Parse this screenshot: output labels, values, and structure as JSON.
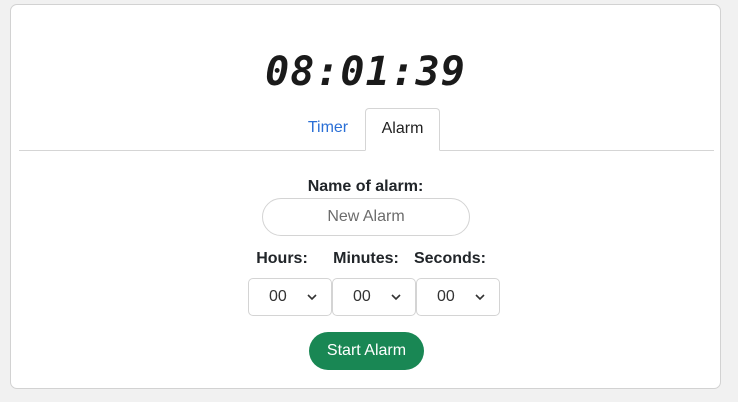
{
  "clock": {
    "time": "08:01:39"
  },
  "tabs": [
    {
      "label": "Timer",
      "active": false
    },
    {
      "label": "Alarm",
      "active": true
    }
  ],
  "form": {
    "name_label": "Name of alarm:",
    "name_placeholder": "New Alarm",
    "name_value": "",
    "hours_label": "Hours:",
    "minutes_label": "Minutes:",
    "seconds_label": "Seconds:",
    "hours_value": "00",
    "minutes_value": "00",
    "seconds_value": "00",
    "start_label": "Start Alarm"
  },
  "colors": {
    "accent_link": "#2a6fd6",
    "start_button": "#198754"
  },
  "icons": {
    "dropdown": "chevron-down-icon"
  }
}
